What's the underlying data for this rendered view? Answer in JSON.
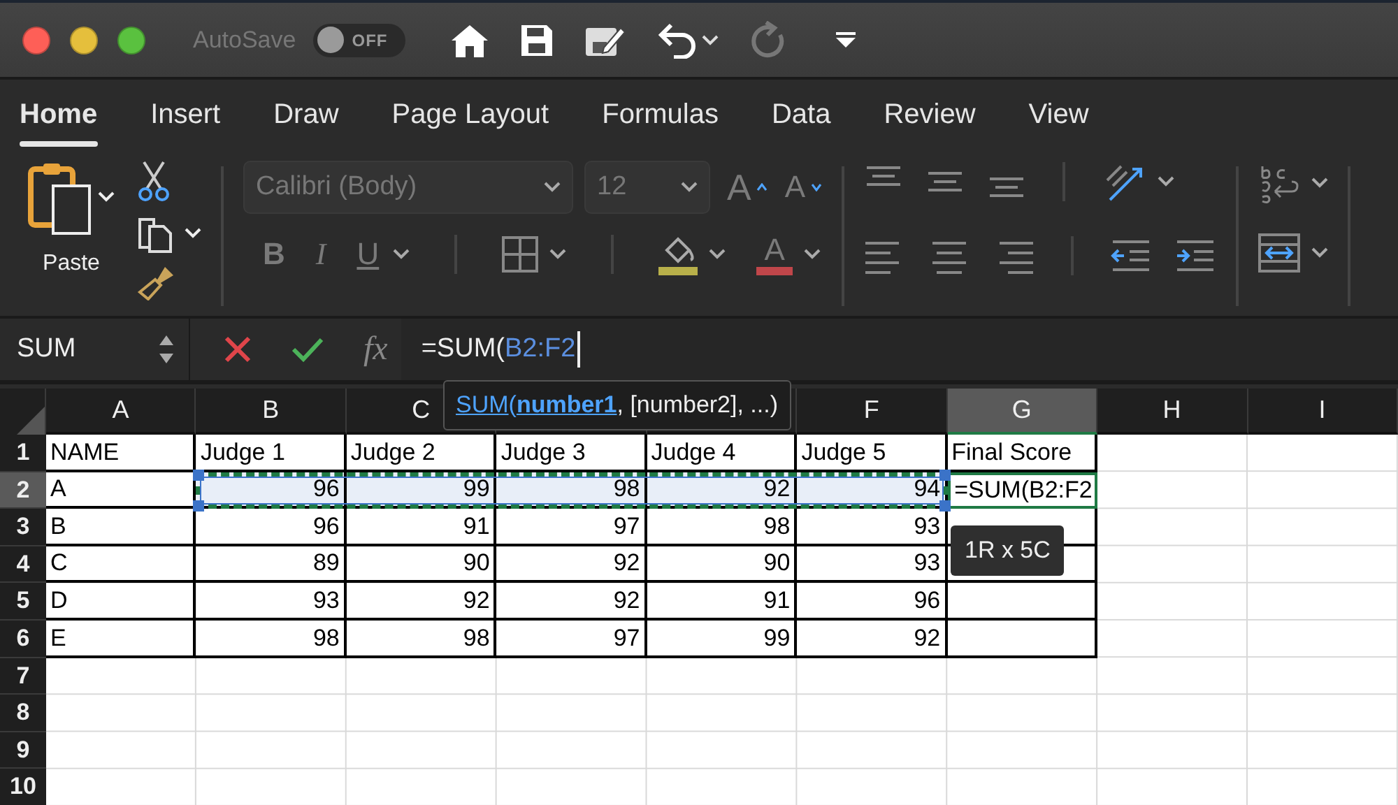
{
  "title_bar": {
    "autosave_label": "AutoSave",
    "autosave": {
      "on": false,
      "label": "OFF"
    }
  },
  "ribbon_tabs": [
    {
      "label": "Home",
      "selected": true
    },
    {
      "label": "Insert",
      "selected": false
    },
    {
      "label": "Draw",
      "selected": false
    },
    {
      "label": "Page Layout",
      "selected": false
    },
    {
      "label": "Formulas",
      "selected": false
    },
    {
      "label": "Data",
      "selected": false
    },
    {
      "label": "Review",
      "selected": false
    },
    {
      "label": "View",
      "selected": false
    }
  ],
  "ribbon": {
    "paste_label": "Paste",
    "font_name": "Calibri (Body)",
    "font_size": "12",
    "grow_letter": "A",
    "shrink_letter": "A",
    "style_letters": [
      "B",
      "I",
      "U"
    ],
    "font_color_letter": "A"
  },
  "formula_bar": {
    "name_box": "SUM",
    "fx": "fx",
    "formula_prefix": "=SUM(",
    "formula_reference": "B2:F2"
  },
  "function_tooltip": {
    "function": "SUM",
    "open_paren": "(",
    "current_argument": "number1",
    "rest": ", [number2], ...)"
  },
  "sheet": {
    "columns": [
      {
        "label": "A",
        "selected": false
      },
      {
        "label": "B",
        "selected": false
      },
      {
        "label": "C",
        "selected": false
      },
      {
        "selected": false
      },
      {
        "selected": false
      },
      {
        "label": "F",
        "selected": false
      },
      {
        "label": "G",
        "selected": true
      },
      {
        "label": "H",
        "selected": false
      },
      {
        "label": "I",
        "selected": false
      }
    ],
    "rows": [
      {
        "label": "1",
        "selected": false,
        "cells": [
          "NAME",
          "Judge 1",
          "Judge 2",
          "Judge 3",
          "Judge 4",
          "Judge 5",
          "Final Score"
        ]
      },
      {
        "label": "2",
        "selected": true,
        "in_range": true,
        "cells": [
          "A",
          "96",
          "99",
          "98",
          "92",
          "94",
          "=SUM(B2:F2"
        ]
      },
      {
        "label": "3",
        "selected": false,
        "cells": [
          "B",
          "96",
          "91",
          "97",
          "98",
          "93"
        ]
      },
      {
        "label": "4",
        "selected": false,
        "cells": [
          "C",
          "89",
          "90",
          "92",
          "90",
          "93"
        ]
      },
      {
        "label": "5",
        "selected": false,
        "cells": [
          "D",
          "93",
          "92",
          "92",
          "91",
          "96"
        ]
      },
      {
        "label": "6",
        "selected": false,
        "cells": [
          "E",
          "98",
          "98",
          "97",
          "99",
          "92"
        ]
      },
      {
        "label": "7",
        "selected": false
      },
      {
        "label": "8",
        "selected": false
      },
      {
        "label": "9",
        "selected": false
      },
      {
        "label": "10",
        "selected": false
      }
    ]
  },
  "selection_size_tooltip": "1R x 5C"
}
